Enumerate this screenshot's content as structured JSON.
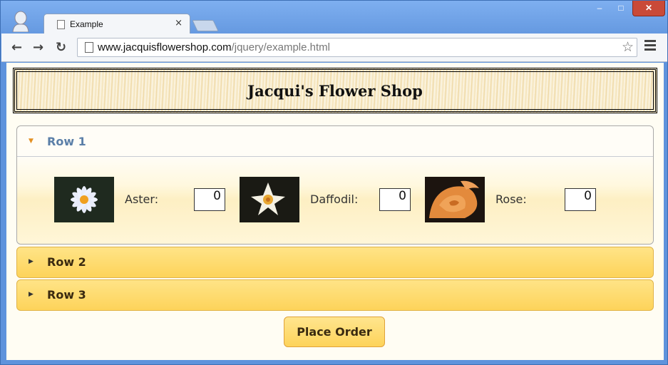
{
  "browser": {
    "tab_title": "Example",
    "tab_close": "×",
    "url_host": "www.jacquisflowershop.com",
    "url_path": "/jquery/example.html",
    "window_controls": {
      "minimize": "–",
      "maximize": "□",
      "close": "✕"
    },
    "icons": {
      "back": "back-arrow-icon",
      "forward": "forward-arrow-icon",
      "reload": "reload-icon",
      "star": "star-icon",
      "menu": "menu-icon"
    }
  },
  "page": {
    "banner_title": "Jacqui's Flower Shop",
    "accordion": [
      {
        "label": "Row 1",
        "expanded": true,
        "flowers": [
          {
            "name": "Aster:",
            "qty": "0"
          },
          {
            "name": "Daffodil:",
            "qty": "0"
          },
          {
            "name": "Rose:",
            "qty": "0"
          }
        ]
      },
      {
        "label": "Row 2",
        "expanded": false
      },
      {
        "label": "Row 3",
        "expanded": false
      }
    ],
    "order_button": "Place Order"
  },
  "colors": {
    "accent": "#fdd35a",
    "header_text": "#5b7fa8",
    "close_button": "#c94a38"
  }
}
